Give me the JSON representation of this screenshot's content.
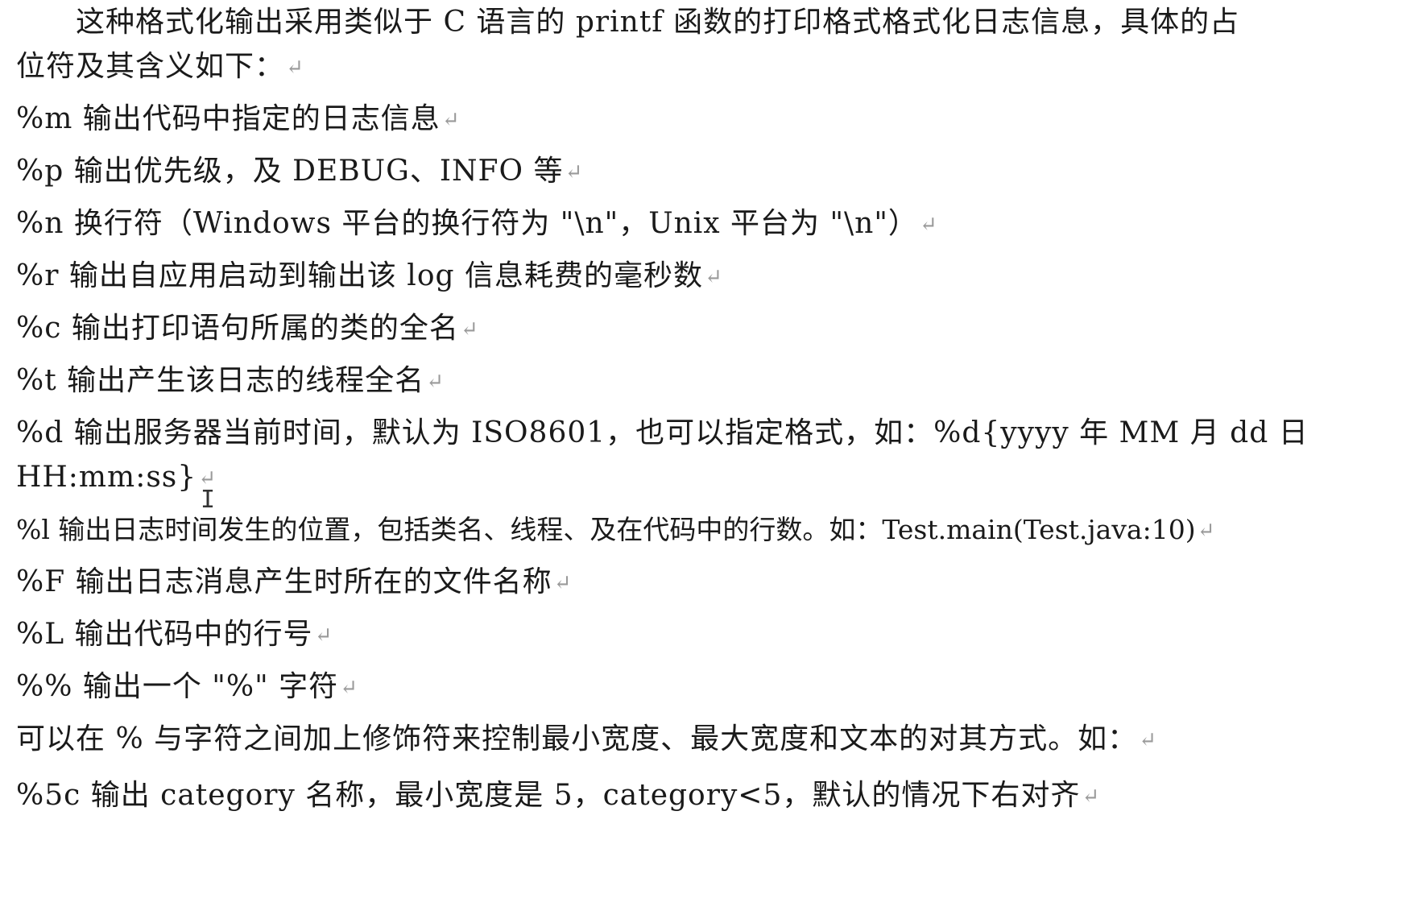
{
  "paragraph_mark": "↵",
  "intro": {
    "line1": "这种格式化输出采用类似于 C 语言的 printf 函数的打印格式格式化日志信息，具体的占",
    "line2": "位符及其含义如下："
  },
  "placeholders": [
    "%m 输出代码中指定的日志信息",
    "%p 输出优先级，及 DEBUG、INFO 等",
    "%n 换行符（Windows 平台的换行符为 \"\\n\"，Unix 平台为 \"\\n\"）",
    "%r 输出自应用启动到输出该 log 信息耗费的毫秒数",
    "%c 输出打印语句所属的类的全名",
    "%t 输出产生该日志的线程全名",
    "%d 输出服务器当前时间，默认为 ISO8601，也可以指定格式，如：%d{yyyy 年 MM 月 dd 日",
    "HH:mm:ss}",
    "%l 输出日志时间发生的位置，包括类名、线程、及在代码中的行数。如：Test.main(Test.java:10)",
    "%F 输出日志消息产生时所在的文件名称",
    "%L 输出代码中的行号",
    "%% 输出一个 \"%\" 字符"
  ],
  "modifier_intro": "可以在 % 与字符之间加上修饰符来控制最小宽度、最大宽度和文本的对其方式。如：",
  "example": "%5c 输出 category 名称，最小宽度是 5，category<5，默认的情况下右对齐",
  "cursor_glyph": "I"
}
